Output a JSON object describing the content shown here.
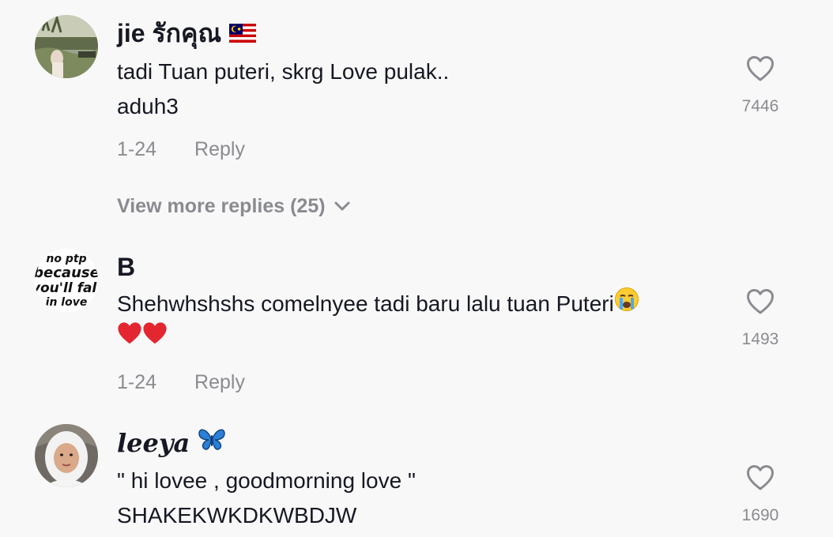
{
  "comments": [
    {
      "username": "jie รักคุณ",
      "flag_icon": "malaysia-flag-icon",
      "lines": [
        "tadi Tuan puteri, skrg Love pulak..",
        "aduh3"
      ],
      "date": "1-24",
      "reply_label": "Reply",
      "like_count": "7446",
      "view_more": "View more replies (25)"
    },
    {
      "username": "B",
      "avatar_text": [
        "no ptp",
        "because",
        "you'll fall",
        "in love"
      ],
      "lines": [
        "Shehwhshshs comelnyee tadi baru lalu tuan Puteri"
      ],
      "emoji_inline": "crying-face-icon",
      "emoji_line": [
        "red-heart-icon",
        "red-heart-icon"
      ],
      "date": "1-24",
      "reply_label": "Reply",
      "like_count": "1493"
    },
    {
      "username": "leeya",
      "badge_icon": "blue-butterfly-icon",
      "lines": [
        "\" hi lovee , goodmorning love \"",
        "SHAKEKWKDKWBDJW"
      ],
      "like_count": "1690"
    }
  ],
  "colors": {
    "background": "#f8f8f8",
    "text_primary": "#161823",
    "text_secondary": "#8a8b91",
    "heart_red": "#e3262f",
    "butterfly_blue": "#2b7fd6"
  }
}
